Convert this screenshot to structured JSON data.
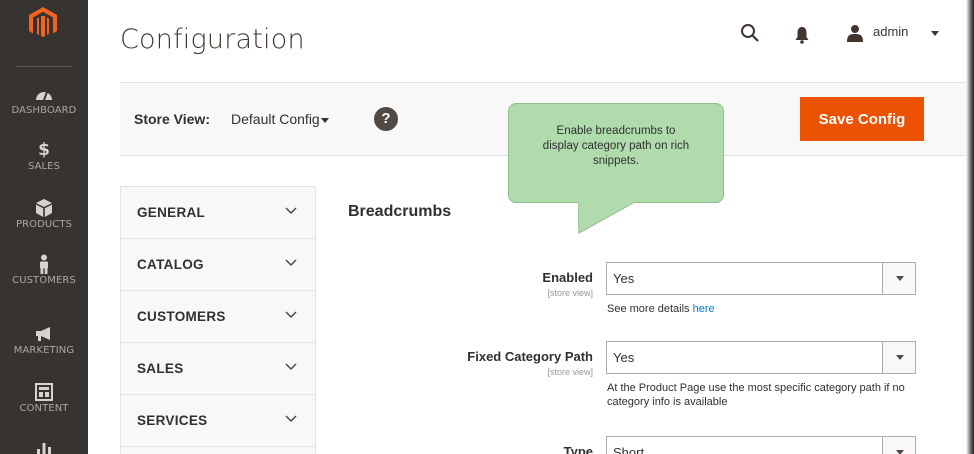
{
  "sidebar": {
    "items": [
      {
        "label": "DASHBOARD",
        "icon": "dashboard-icon"
      },
      {
        "label": "SALES",
        "icon": "dollar-icon",
        "glyph": "$"
      },
      {
        "label": "PRODUCTS",
        "icon": "box-icon"
      },
      {
        "label": "CUSTOMERS",
        "icon": "person-icon"
      },
      {
        "label": "MARKETING",
        "icon": "megaphone-icon"
      },
      {
        "label": "CONTENT",
        "icon": "layout-icon"
      },
      {
        "label": "",
        "icon": "chart-icon"
      }
    ]
  },
  "header": {
    "title": "Configuration",
    "user": "admin"
  },
  "store_bar": {
    "label": "Store View:",
    "value": "Default Config",
    "help": "?",
    "save_label": "Save Config"
  },
  "tooltip": {
    "text": "Enable breadcrumbs to display category path on rich snippets."
  },
  "tabs": [
    {
      "label": "GENERAL"
    },
    {
      "label": "CATALOG"
    },
    {
      "label": "CUSTOMERS"
    },
    {
      "label": "SALES"
    },
    {
      "label": "SERVICES"
    }
  ],
  "section": {
    "title": "Breadcrumbs",
    "fields": [
      {
        "label": "Enabled",
        "scope": "[store view]",
        "value": "Yes",
        "note_prefix": "See more details ",
        "note_link": "here"
      },
      {
        "label": "Fixed Category Path",
        "scope": "[store view]",
        "value": "Yes",
        "note": "At the Product Page use the most specific category path if no category info is available"
      },
      {
        "label": "Type",
        "value": "Short"
      }
    ]
  },
  "colors": {
    "sidebar_bg": "#373330",
    "accent": "#eb5202",
    "logo": "#f26322",
    "tooltip_bg": "#b0dbad",
    "link": "#007bdb"
  }
}
